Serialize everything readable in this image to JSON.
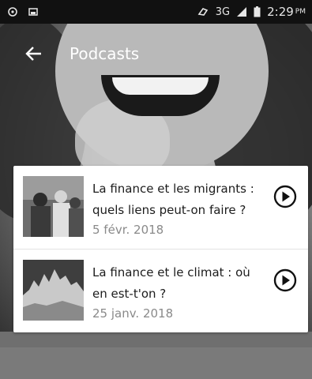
{
  "status_bar": {
    "network": "3G",
    "time": "2:29",
    "ampm": "PM"
  },
  "app_bar": {
    "back_icon": "arrow-back-icon",
    "title": "Podcasts"
  },
  "podcasts": [
    {
      "title": "La finance et les migrants : quels liens peut-on faire ?",
      "date": "5 févr. 2018",
      "icon": "play-circle-icon"
    },
    {
      "title": "La finance et le climat : où en est-t'on ?",
      "date": "25 janv. 2018",
      "icon": "play-circle-icon"
    }
  ]
}
